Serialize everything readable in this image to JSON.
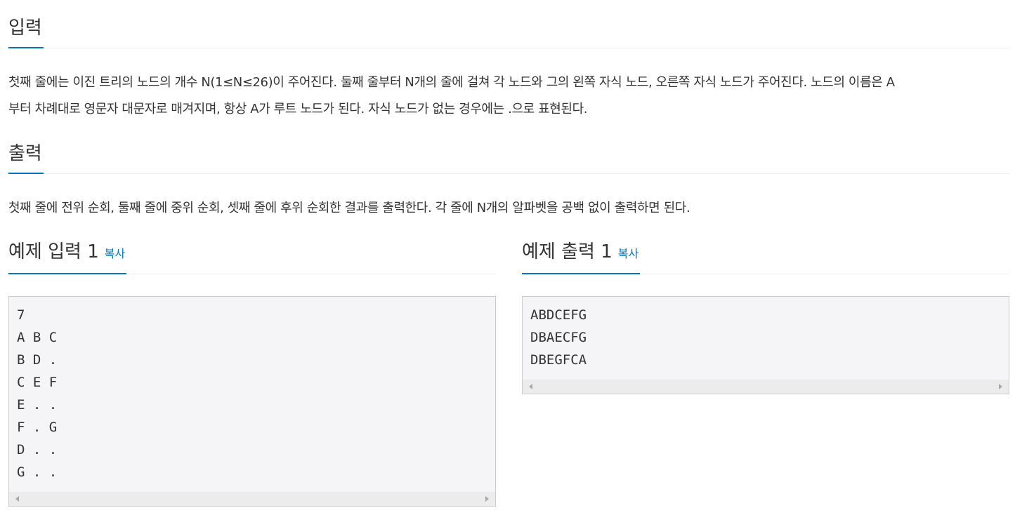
{
  "input_section": {
    "title": "입력",
    "line1": "첫째 줄에는 이진 트리의 노드의 개수 N(1≤N≤26)이 주어진다. 둘째 줄부터 N개의 줄에 걸쳐 각 노드와 그의 왼쪽 자식 노드, 오른쪽 자식 노드가 주어진다. 노드의 이름은 A",
    "line2": "부터 차례대로 영문자 대문자로 매겨지며, 항상 A가 루트 노드가 된다. 자식 노드가 없는 경우에는 .으로 표현된다."
  },
  "output_section": {
    "title": "출력",
    "text": "첫째 줄에 전위 순회, 둘째 줄에 중위 순회, 셋째 줄에 후위 순회한 결과를 출력한다. 각 줄에 N개의 알파벳을 공백 없이 출력하면 된다."
  },
  "sample_input": {
    "title": "예제 입력 1",
    "copy_label": "복사",
    "content": "7\nA B C\nB D .\nC E F\nE . .\nF . G\nD . .\nG . ."
  },
  "sample_output": {
    "title": "예제 출력 1",
    "copy_label": "복사",
    "content": "ABDCEFG\nDBAECFG\nDBEGFCA"
  }
}
